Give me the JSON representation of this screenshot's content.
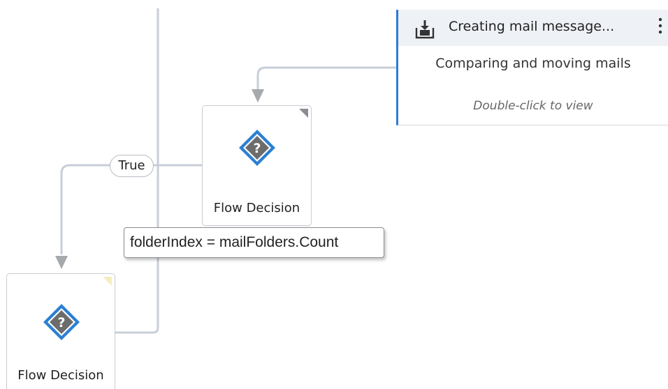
{
  "activity": {
    "title": "Creating mail message...",
    "subtitle": "Comparing and moving mails",
    "hint": "Double-click to view",
    "menu_icon": "more-vertical-icon",
    "icon": "download-tray-icon",
    "accent_color": "#2e7bd6"
  },
  "decisions": [
    {
      "label": "Flow Decision",
      "icon": "question-diamond-icon"
    },
    {
      "label": "Flow Decision",
      "icon": "question-diamond-icon"
    }
  ],
  "condition_label": "True",
  "tooltip": "folderIndex = mailFolders.Count",
  "colors": {
    "connector": "#c8ced8",
    "arrow": "#a6a9ad",
    "diamond_border": "#2b7fd4",
    "diamond_fill": "#6c6c6c"
  }
}
